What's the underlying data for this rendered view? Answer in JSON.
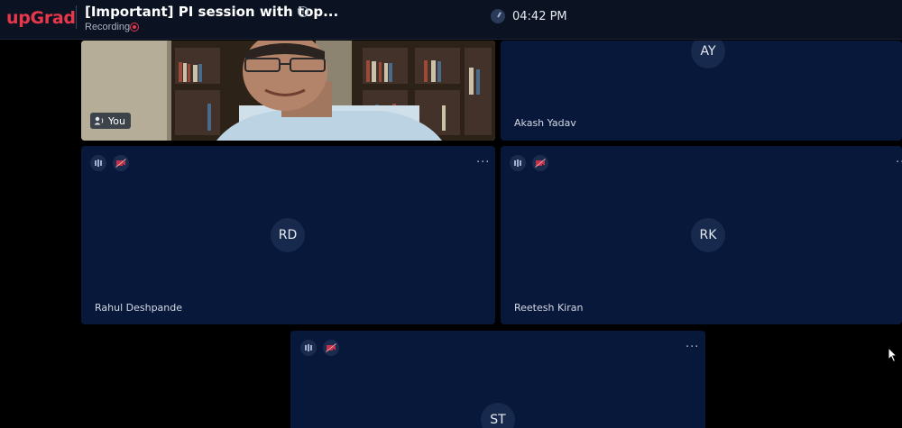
{
  "header": {
    "brand": "upGrad",
    "title": "[Important] PI session with top...",
    "info_icon": "i",
    "recording_label": "Recording",
    "time": "04:42 PM"
  },
  "participants": {
    "self": {
      "badge_label": "You"
    },
    "akash": {
      "initials": "AY",
      "name": "Akash Yadav"
    },
    "rahul": {
      "initials": "RD",
      "name": "Rahul Deshpande"
    },
    "reetesh": {
      "initials": "RK",
      "name": "Reetesh Kiran"
    },
    "st": {
      "initials": "ST"
    }
  },
  "icons": {
    "audio": "audio-level-icon",
    "video_off": "video-off-icon",
    "more": "more-options-icon",
    "speaker": "speaking-icon"
  },
  "more_label": "···",
  "colors": {
    "brand": "#e8374a",
    "tile_bg": "#08183a",
    "header_bg": "#0b1322",
    "avatar_bg": "#17294d"
  }
}
